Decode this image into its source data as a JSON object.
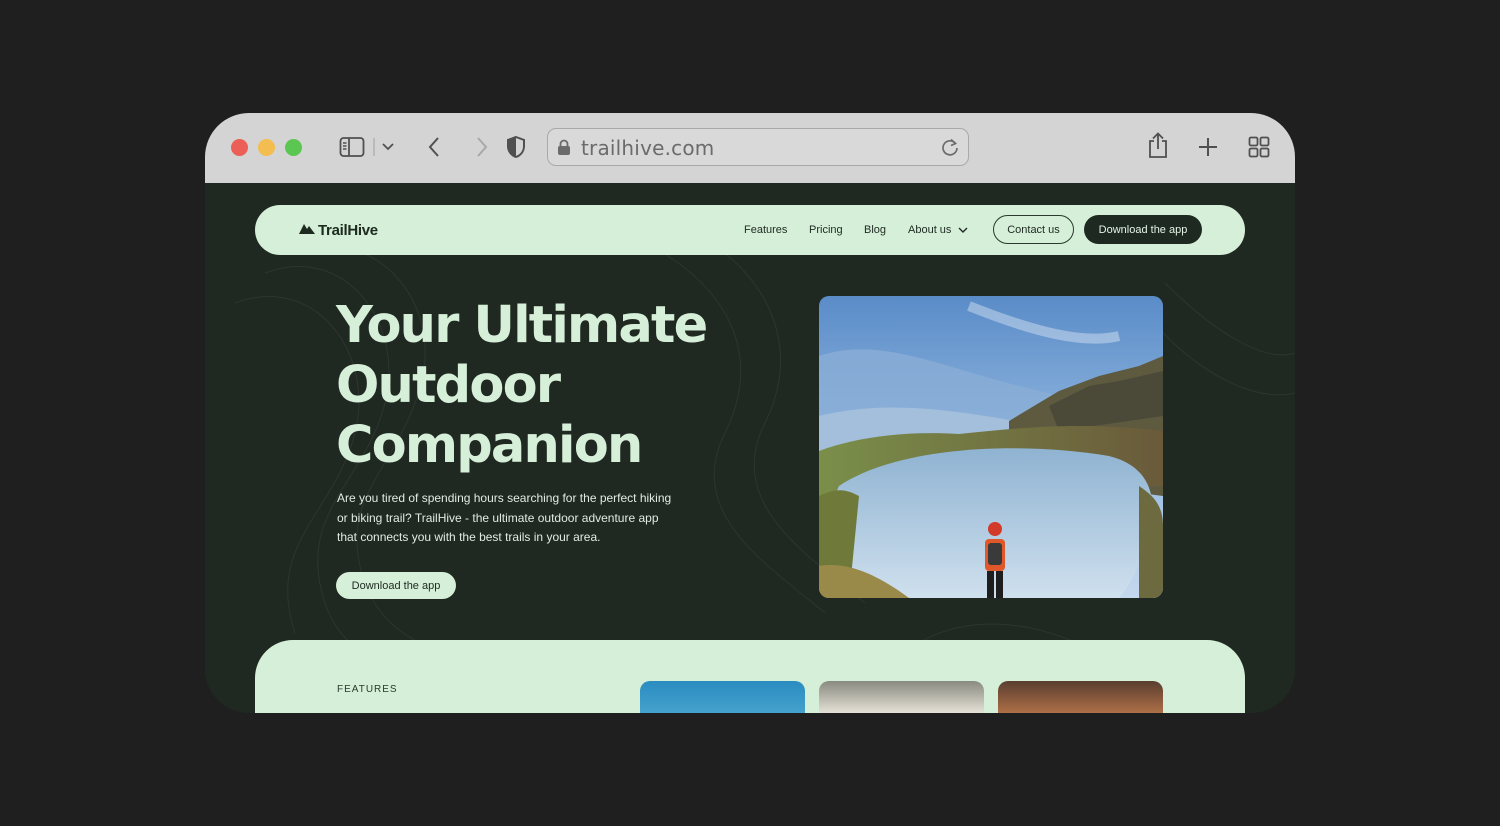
{
  "browser": {
    "url": "trailhive.com"
  },
  "navbar": {
    "logo_text": "TrailHive",
    "links": [
      "Features",
      "Pricing",
      "Blog"
    ],
    "about_label": "About us",
    "contact_label": "Contact us",
    "download_label": "Download the app"
  },
  "hero": {
    "title_lines": [
      "Your Ultimate",
      "Outdoor",
      "Companion"
    ],
    "description_lines": [
      "Are you tired of spending hours searching for the perfect hiking",
      "or biking trail? TrailHive - the ultimate outdoor adventure app",
      "that connects you with the best trails in your area."
    ],
    "cta_label": "Download the app"
  },
  "features": {
    "label": "FEATURES"
  },
  "colors": {
    "page_bg": "#202921",
    "mint": "#d6efd8",
    "dark_green": "#1e2a21"
  }
}
